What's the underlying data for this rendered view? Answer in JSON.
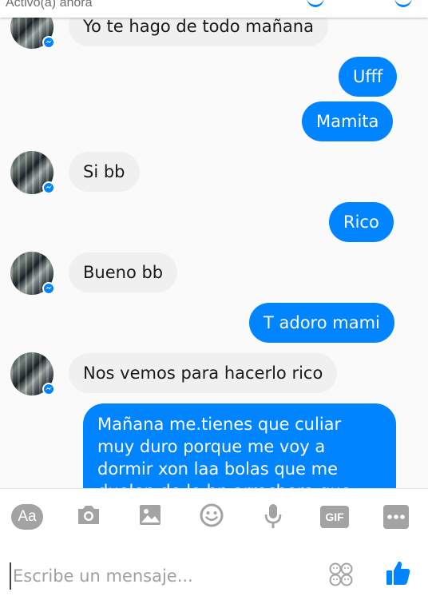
{
  "header": {
    "status": "Activo(a) ahora"
  },
  "conversation": {
    "messages": [
      {
        "sender": "contact",
        "text": "Yo te hago de todo mañana"
      },
      {
        "sender": "me",
        "text": "Ufff"
      },
      {
        "sender": "me",
        "text": "Mamita"
      },
      {
        "sender": "contact",
        "text": "Si bb"
      },
      {
        "sender": "me",
        "text": "Rico"
      },
      {
        "sender": "contact",
        "text": "Bueno bb"
      },
      {
        "sender": "me",
        "text": "T adoro mami"
      },
      {
        "sender": "contact",
        "text": "Nos vemos para hacerlo rico"
      },
      {
        "sender": "me",
        "lines": [
          "Mañana me.tienes que culiar",
          "muy duro porque me voy a",
          "dormir xon laa bolas que me",
          "duelen  de lo bn arrechera que"
        ]
      }
    ]
  },
  "composer": {
    "aa_label": "Aa",
    "gif_label": "GIF",
    "placeholder": "Escribe un mensaje...",
    "icons": [
      "text-format-icon",
      "camera-icon",
      "image-icon",
      "emoji-icon",
      "microphone-icon",
      "gif-icon",
      "more-icon",
      "stickers-icon",
      "like-thumb-icon"
    ]
  },
  "colors": {
    "accent": "#0084ff",
    "incoming_bubble": "#f0f0f0",
    "toolbar_icon": "#a3a3a3"
  }
}
